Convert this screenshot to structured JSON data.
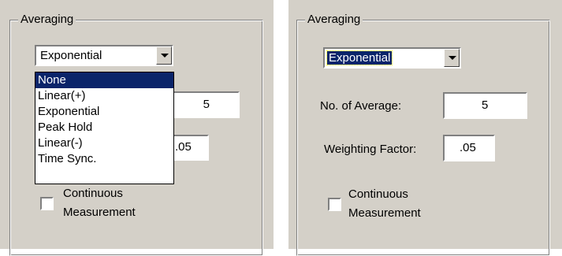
{
  "left_panel": {
    "group_title": "Averaging",
    "mode_combo": {
      "selected": "Exponential"
    },
    "dropdown_options": [
      "None",
      "Linear(+)",
      "Exponential",
      "Peak Hold",
      "Linear(-)",
      "Time Sync."
    ],
    "highlighted_option": "None",
    "no_of_average_value": "5",
    "weighting_factor_value": ".05",
    "continuous_line1": "Continuous",
    "continuous_line2": "Measurement",
    "continuous_checked": false
  },
  "right_panel": {
    "group_title": "Averaging",
    "mode_combo": {
      "selected": "Exponential"
    },
    "no_of_average_label": "No. of Average:",
    "no_of_average_value": "5",
    "weighting_factor_label": "Weighting Factor:",
    "weighting_factor_value": ".05",
    "continuous_line1": "Continuous",
    "continuous_line2": "Measurement",
    "continuous_checked": false
  },
  "colors": {
    "dialog_background": "#d4d0c8",
    "selection_highlight": "#0a246a"
  }
}
